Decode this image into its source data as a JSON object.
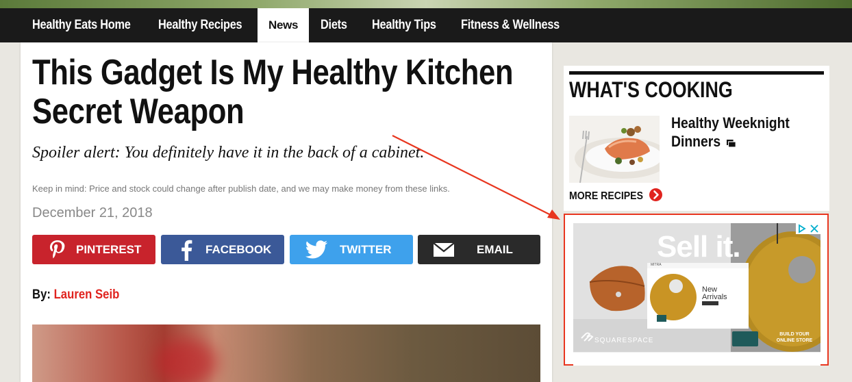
{
  "nav": {
    "items": [
      {
        "label": "Healthy Eats Home"
      },
      {
        "label": "Healthy Recipes"
      },
      {
        "label": "News",
        "active": true
      },
      {
        "label": "Diets"
      },
      {
        "label": "Healthy Tips"
      },
      {
        "label": "Fitness & Wellness"
      }
    ]
  },
  "article": {
    "headline": "This Gadget Is My Healthy Kitchen Secret Weapon",
    "subhead": "Spoiler alert: You definitely have it in the back of a cabinet.",
    "disclaimer": "Keep in mind: Price and stock could change after publish date, and we may make money from these links.",
    "date": "December 21, 2018",
    "byline_prefix": "By:",
    "author": "Lauren Seib"
  },
  "share": {
    "pinterest": {
      "label": "PINTEREST",
      "color": "#c8232c",
      "icon": "pinterest-icon"
    },
    "facebook": {
      "label": "FACEBOOK",
      "color": "#3b5998",
      "icon": "facebook-icon"
    },
    "twitter": {
      "label": "TWITTER",
      "color": "#3ea1ec",
      "icon": "twitter-icon"
    },
    "email": {
      "label": "EMAIL",
      "color": "#2a2a2a",
      "icon": "envelope-icon"
    }
  },
  "sidebar": {
    "title": "WHAT'S COOKING",
    "recipe_title": "Healthy Weeknight Dinners",
    "more_label": "MORE RECIPES",
    "more_icon": "chevron-right-circle-icon"
  },
  "ad": {
    "headline": "Sell it.",
    "brand": "SQUARESPACE",
    "cta": "BUILD YOUR ONLINE STORE",
    "mock_brand": "MITRA",
    "mock_text": "New Arrivals",
    "adchoices_icon": "adchoices-icon",
    "close_icon": "close-icon"
  },
  "colors": {
    "accent_red": "#e0231e",
    "nav_bg": "#1a1a1a",
    "annotation": "#e8361f"
  }
}
